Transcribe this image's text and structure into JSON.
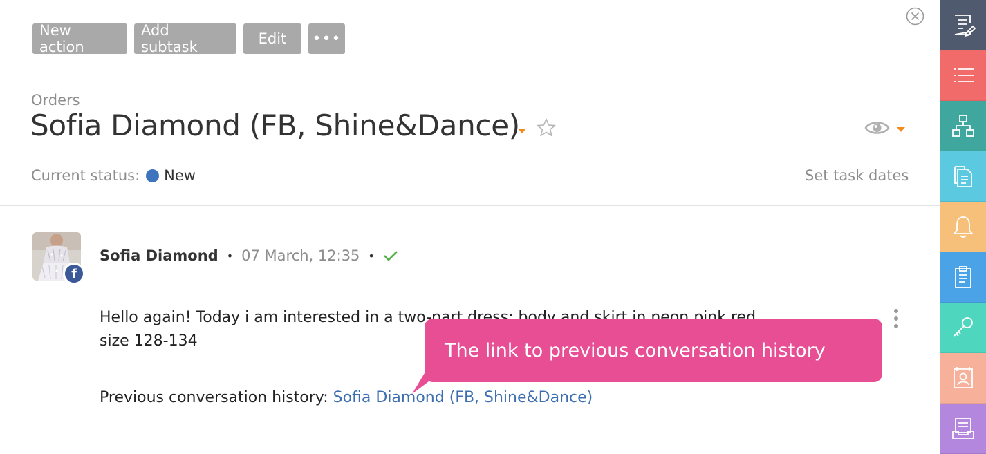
{
  "toolbar": {
    "new_action": "New action",
    "add_subtask": "Add subtask",
    "edit": "Edit",
    "more": "•••"
  },
  "task": {
    "breadcrumb": "Orders",
    "title": "Sofia Diamond (FB, Shine&Dance)",
    "status_label": "Current status:",
    "status_value": "New",
    "set_dates": "Set task dates"
  },
  "message": {
    "author": "Sofia Diamond",
    "time": "07 March, 12:35",
    "text": "Hello again! Today i am interested in a two-part dress: body and skirt in neon pink red. size 128-134",
    "history_label": "Previous conversation history:",
    "history_link": "Sofia Diamond (FB, Shine&Dance)",
    "badge": "f"
  },
  "callout": {
    "text": "The link to previous conversation history"
  },
  "colors": {
    "accent_orange": "#f28a1e",
    "status_blue": "#3d74bd",
    "callout_pink": "#e84e94",
    "button_gray": "#a9a9a9",
    "link_blue": "#3d6fb0"
  },
  "sidebar": {
    "items": [
      {
        "icon": "edit-note-icon",
        "color": "#505a6e"
      },
      {
        "icon": "list-icon",
        "color": "#f26b6b"
      },
      {
        "icon": "hierarchy-icon",
        "color": "#3fa79e"
      },
      {
        "icon": "documents-icon",
        "color": "#5bc9e0"
      },
      {
        "icon": "bell-icon",
        "color": "#f6c07a"
      },
      {
        "icon": "clipboard-icon",
        "color": "#4aa3e6"
      },
      {
        "icon": "key-icon",
        "color": "#4fd6bf"
      },
      {
        "icon": "contact-card-icon",
        "color": "#f7b09a"
      },
      {
        "icon": "inbox-icon",
        "color": "#b487de"
      }
    ]
  }
}
